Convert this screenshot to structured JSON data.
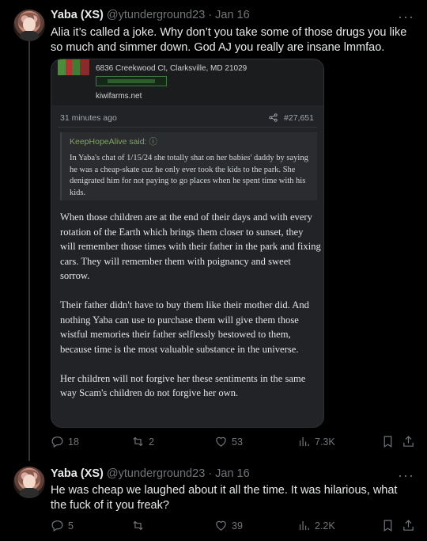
{
  "tweets": [
    {
      "name": "Yaba (XS)",
      "handle": "@ytunderground23 · Jan 16",
      "text": "Alia it’s called a joke. Why don’t you take some of those drugs you like so much and simmer down.  God AJ you really are insane lmmfao.",
      "replies": "18",
      "retweets": "2",
      "likes": "53",
      "views": "7.3K",
      "media": {
        "address": "6836 Creekwood Ct, Clarksville, MD 21029",
        "site": "kiwifarms.net",
        "time_ago": "31 minutes ago",
        "post_number": "#27,651",
        "quote_author": "KeepHopeAlive said: ⓘ",
        "quote_text": "In Yaba's chat of 1/15/24 she totally shat on her babies' daddy by saying he was a cheap-skate cuz he only ever took the kids to the park. She denigrated him for not paying to go places when he spent time with his kids.",
        "para1": "When those children are at the end of their days and with every rotation of the Earth which brings them closer to sunset, they will remember those times with their father in the park and fixing cars. They will remember them with poignancy and sweet sorrow.",
        "para2": "Their father didn't have to buy them like their mother did. And nothing Yaba can use to purchase them will give them those wistful memories their father selflessly bestowed to them, because time is the most valuable substance in the universe.",
        "para3": "Her children will not forgive her these sentiments in the same way Scam's children do not forgive her own."
      }
    },
    {
      "name": "Yaba (XS)",
      "handle": "@ytunderground23 · Jan 16",
      "text": "He was cheap we laughed about it all the time. It was hilarious, what the fuck of it you freak?",
      "replies": "5",
      "retweets": "",
      "likes": "39",
      "views": "2.2K"
    }
  ],
  "more_label": "···",
  "icons": [
    "reply-icon",
    "retweet-icon",
    "like-icon",
    "views-icon",
    "bookmark-icon",
    "share-icon",
    "more-icon"
  ]
}
